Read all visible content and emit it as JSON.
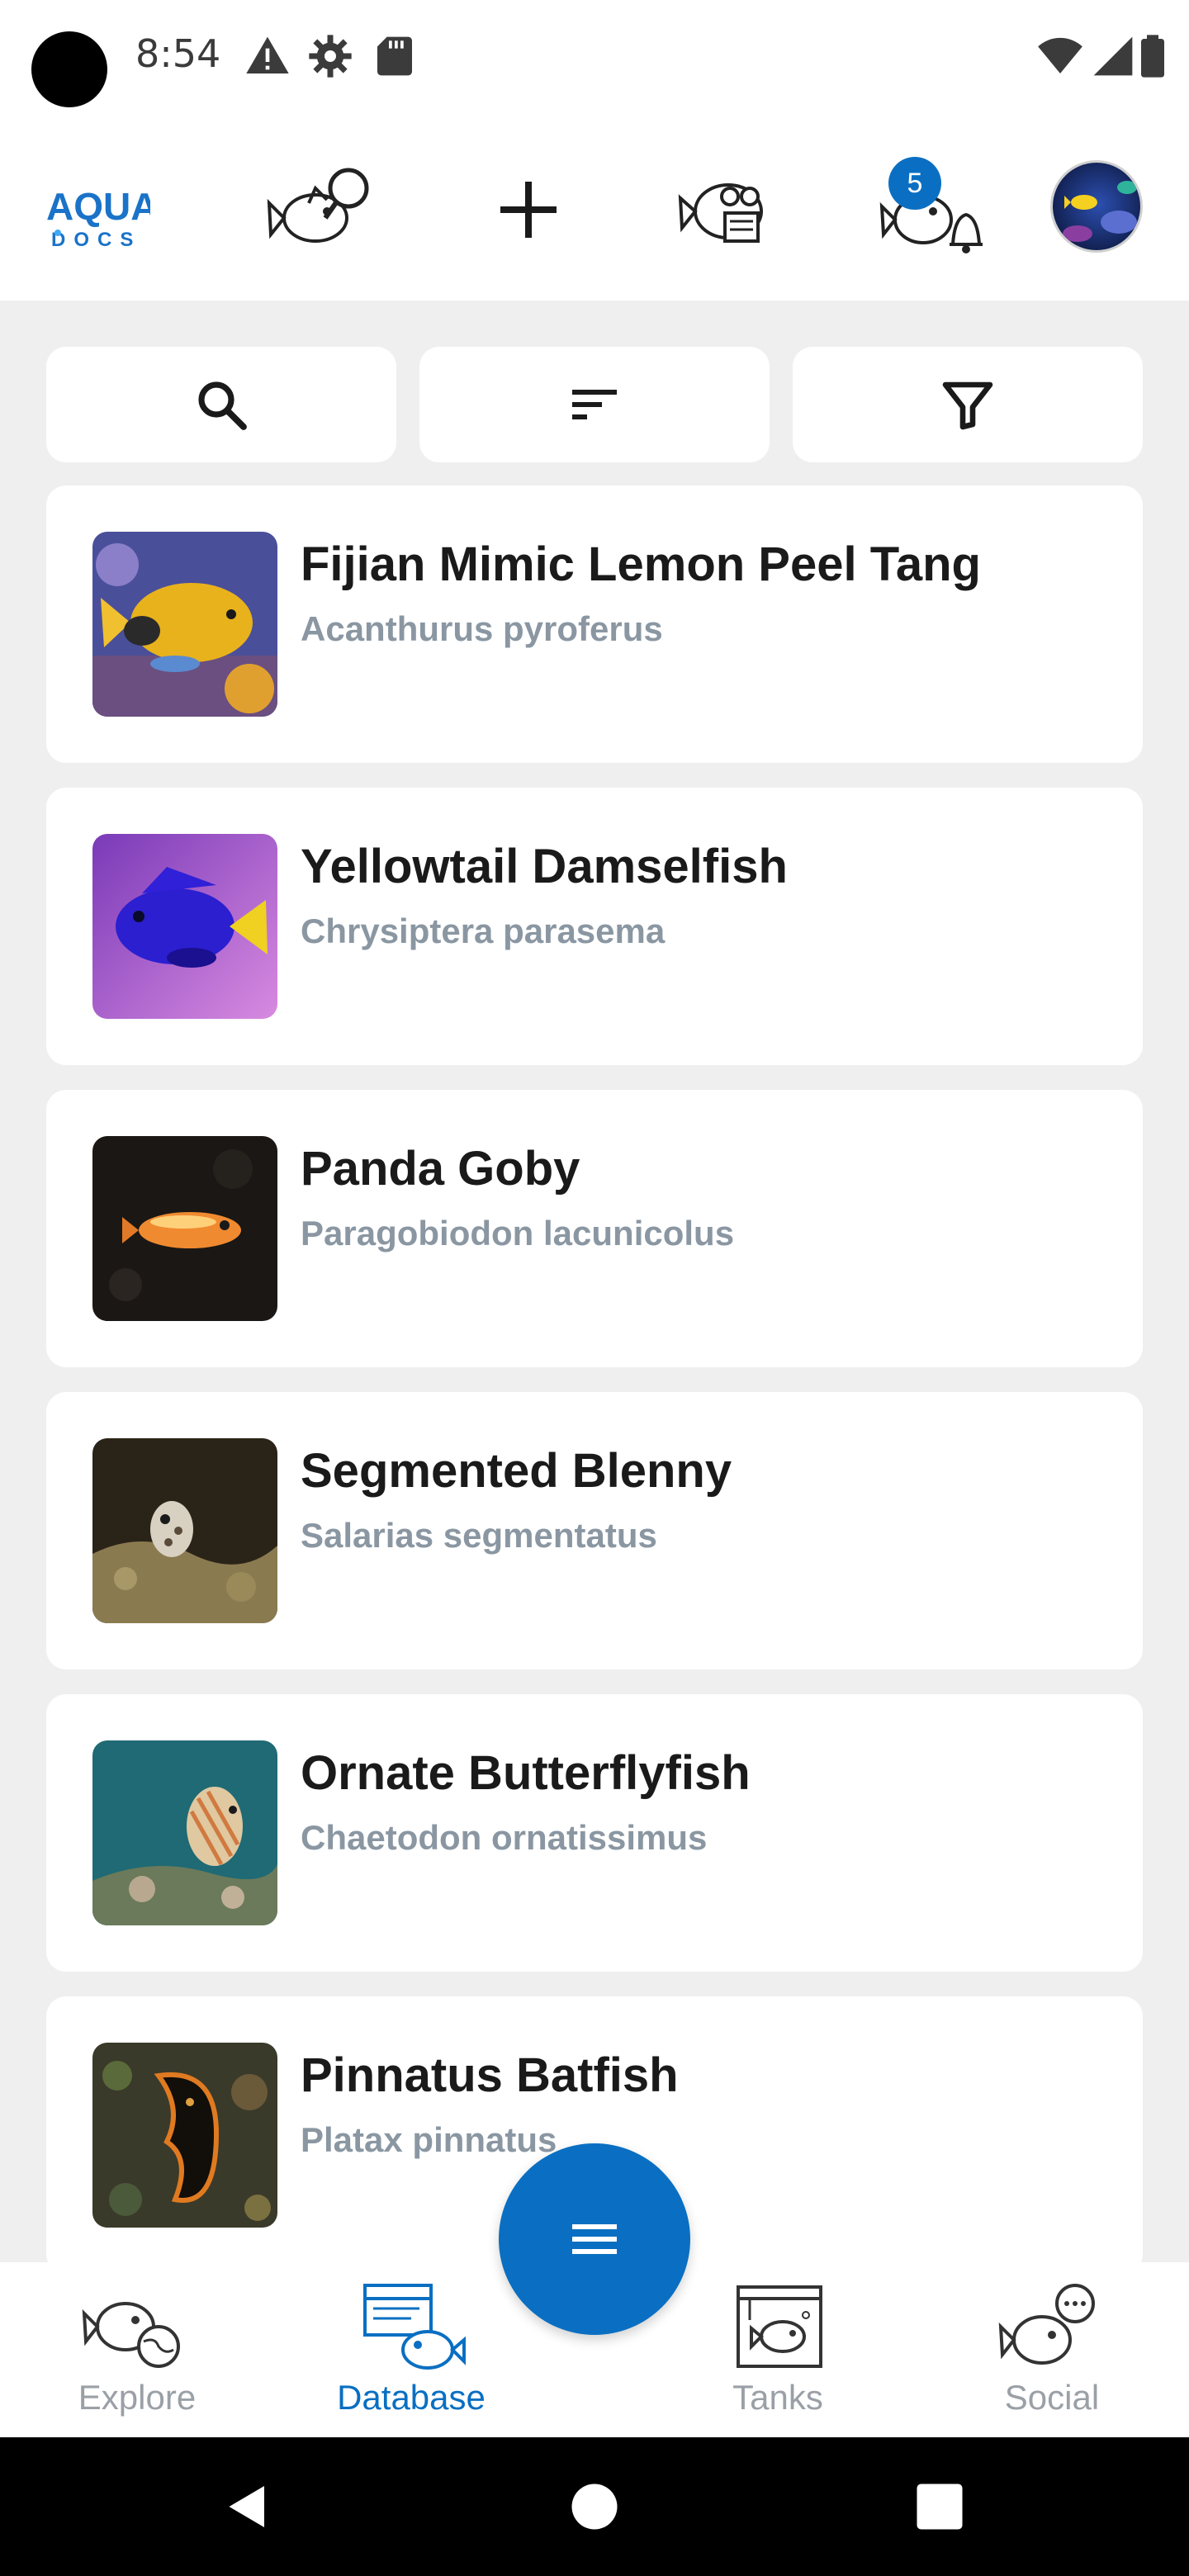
{
  "status_bar": {
    "time": "8:54",
    "left_icons": [
      "warning-icon",
      "gear-icon",
      "sd-card-icon"
    ],
    "right_icons": [
      "wifi-icon",
      "cell-signal-icon",
      "battery-icon"
    ]
  },
  "top_bar": {
    "logo_text_top": "AQUA",
    "logo_text_bottom": "DOCS",
    "notification_count": "5",
    "items": [
      "fish-search-icon",
      "add-icon",
      "fish-reading-icon",
      "fish-bell-icon",
      "avatar"
    ]
  },
  "toolbar": {
    "search_icon": "search-icon",
    "sort_icon": "sort-icon",
    "filter_icon": "filter-icon"
  },
  "species": [
    {
      "common_name": "Fijian Mimic Lemon Peel Tang",
      "scientific_name": "Acanthurus pyroferus"
    },
    {
      "common_name": "Yellowtail Damselfish",
      "scientific_name": "Chrysiptera parasema"
    },
    {
      "common_name": "Panda Goby",
      "scientific_name": "Paragobiodon lacunicolus"
    },
    {
      "common_name": "Segmented Blenny",
      "scientific_name": "Salarias segmentatus"
    },
    {
      "common_name": "Ornate Butterflyfish",
      "scientific_name": "Chaetodon ornatissimus"
    },
    {
      "common_name": "Pinnatus Batfish",
      "scientific_name": "Platax pinnatus"
    }
  ],
  "bottom_nav": {
    "items": [
      {
        "label": "Explore",
        "icon": "fish-globe-icon",
        "active": false
      },
      {
        "label": "Database",
        "icon": "fish-database-icon",
        "active": true
      },
      {
        "label": "Tanks",
        "icon": "fish-tank-icon",
        "active": false
      },
      {
        "label": "Social",
        "icon": "fish-chat-icon",
        "active": false
      }
    ]
  },
  "colors": {
    "accent": "#0a6fc2",
    "background": "#efefef",
    "card": "#ffffff",
    "scientific_name": "#8a97a2",
    "inactive_nav": "#9aa0a6"
  }
}
